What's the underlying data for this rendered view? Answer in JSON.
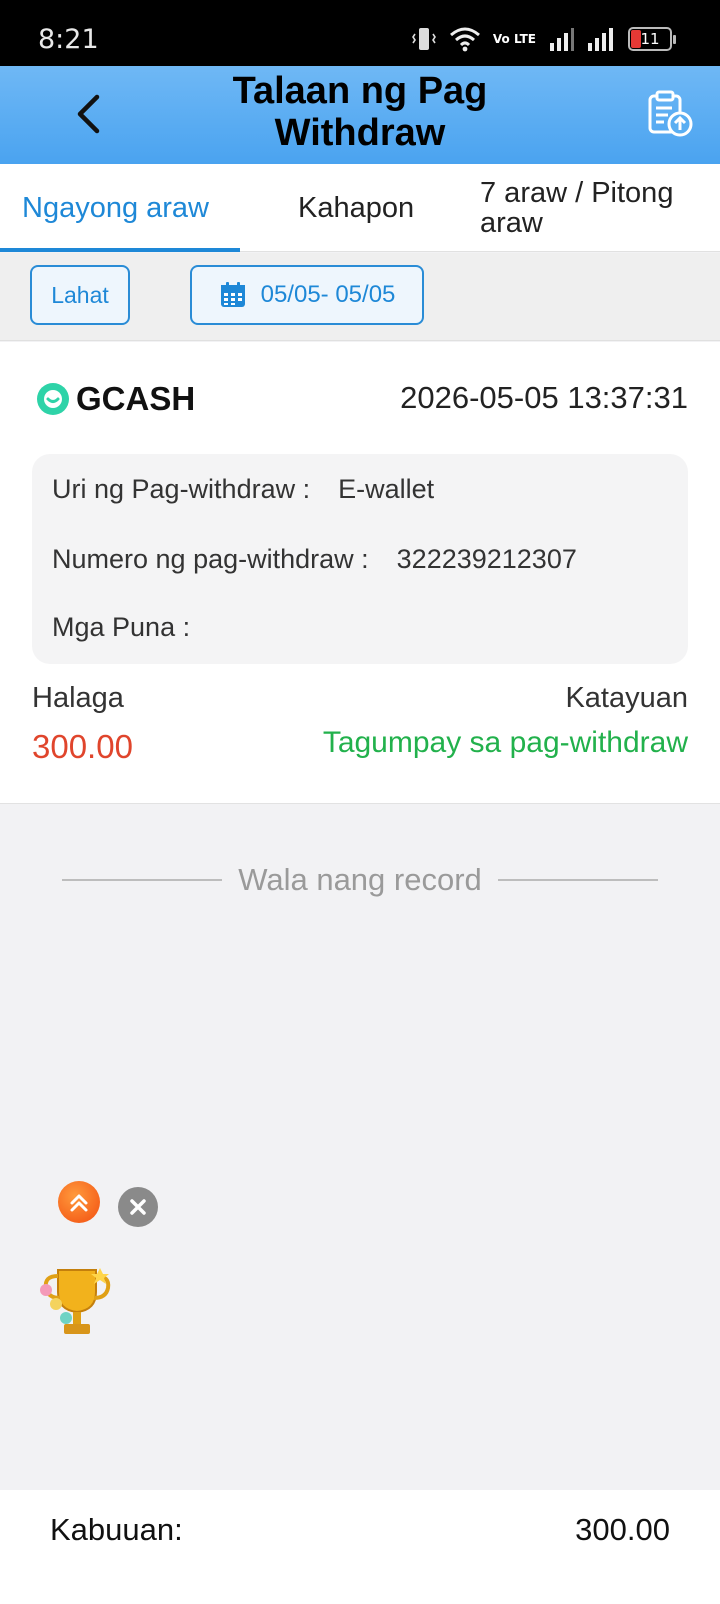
{
  "status_bar": {
    "time": "8:21",
    "battery": "11",
    "network_label": "Vo LTE",
    "icons": [
      "vibrate-icon",
      "wifi-icon",
      "volte-icon",
      "signal-icon",
      "signal-icon",
      "battery-icon"
    ]
  },
  "header": {
    "title": "Talaan ng Pag Withdraw",
    "back_icon": "chevron-left-icon",
    "action_icon": "clipboard-upload-icon"
  },
  "tabs": [
    {
      "label": "Ngayong araw",
      "active": true
    },
    {
      "label": "Kahapon",
      "active": false
    },
    {
      "label": "7 araw / Pitong araw",
      "active": false
    }
  ],
  "filters": {
    "all_label": "Lahat",
    "date_range": "05/05- 05/05",
    "date_icon": "calendar-icon"
  },
  "record": {
    "provider": "GCASH",
    "datetime": "2026-05-05 13:37:31",
    "type_label": "Uri ng Pag-withdraw :",
    "type_value": "E-wallet",
    "number_label": "Numero ng pag-withdraw :",
    "number_value": "322239212307",
    "remarks_label": "Mga Puna :",
    "remarks_value": "",
    "amount_label": "Halaga",
    "amount_value": "300.00",
    "status_label": "Katayuan",
    "status_value": "Tagumpay sa pag-withdraw",
    "colors": {
      "amount": "#e0452c",
      "status": "#22b14c",
      "accent": "#1e88d7",
      "gcash": "#2ed3a8"
    }
  },
  "empty_note": "Wala nang record",
  "footer": {
    "total_label": "Kabuuan:",
    "total_value": "300.00"
  }
}
